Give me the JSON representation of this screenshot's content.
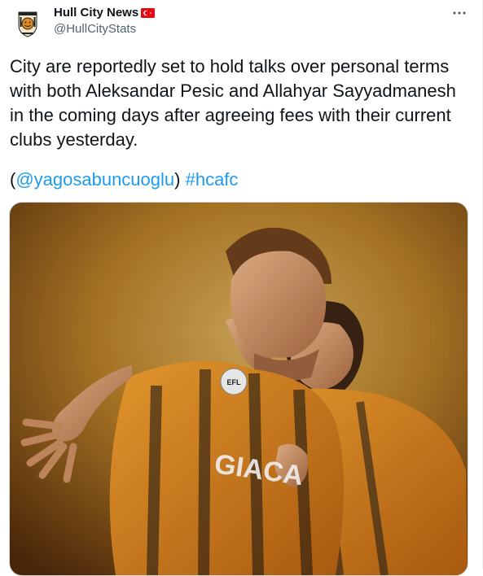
{
  "author": {
    "display_name": "Hull City News",
    "handle": "@HullCityStats",
    "avatar_icon": "hull-city-news-badge",
    "avatar_lettering": [
      "Hull City News",
      "#HCAFC",
      "Hull City News"
    ],
    "flag_icon": "turkey-flag-icon"
  },
  "tweet": {
    "text": "City are reportedly set to hold talks over personal terms with both Aleksandar Pesic and Allahyar Sayyadmanesh in the coming days after agreeing fees with their current clubs yesterday.",
    "open_paren": "(",
    "mention": "@yagosabuncuoglu",
    "close_paren": ")",
    "hashtag": "#hcafc"
  },
  "media": {
    "kit_lettering": "GIACA",
    "badge_lettering": "EFL"
  },
  "colors": {
    "link": "#1d9bf0",
    "text": "#0f1419",
    "secondary": "#536471",
    "kit_amber": "#e08a1e",
    "background_gold": "#d49a3a"
  }
}
